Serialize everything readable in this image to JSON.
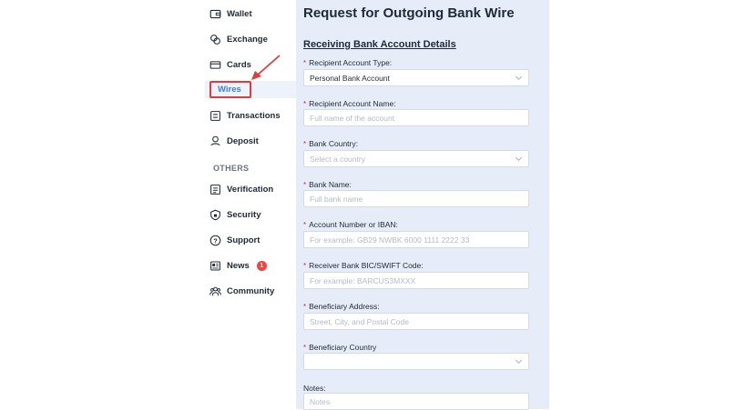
{
  "sidebar": {
    "items": [
      {
        "label": "Wallet",
        "icon": "wallet-icon"
      },
      {
        "label": "Exchange",
        "icon": "exchange-icon"
      },
      {
        "label": "Cards",
        "icon": "card-icon"
      },
      {
        "label": "Wires",
        "icon": "bank-icon"
      },
      {
        "label": "Transactions",
        "icon": "transactions-icon"
      },
      {
        "label": "Deposit",
        "icon": "deposit-icon"
      }
    ],
    "others_label": "OTHERS",
    "others": [
      {
        "label": "Verification",
        "icon": "verification-icon"
      },
      {
        "label": "Security",
        "icon": "shield-icon"
      },
      {
        "label": "Support",
        "icon": "help-icon"
      },
      {
        "label": "News",
        "icon": "news-icon",
        "badge": "1"
      },
      {
        "label": "Community",
        "icon": "community-icon"
      }
    ]
  },
  "form": {
    "title": "Request for Outgoing Bank Wire",
    "section": "Receiving Bank Account Details",
    "fields": [
      {
        "label": "Recipient Account Type:",
        "required": true,
        "value": "Personal Bank Account",
        "placeholder": "",
        "type": "select"
      },
      {
        "label": "Recipient Account Name:",
        "required": true,
        "value": "",
        "placeholder": "Full name of the account",
        "type": "text"
      },
      {
        "label": "Bank Country:",
        "required": true,
        "value": "",
        "placeholder": "Select a country",
        "type": "select"
      },
      {
        "label": "Bank Name:",
        "required": true,
        "value": "",
        "placeholder": "Full bank name",
        "type": "text"
      },
      {
        "label": "Account Number or IBAN:",
        "required": true,
        "value": "",
        "placeholder": "For example: GB29 NWBK 6000 1111 2222 33",
        "type": "text"
      },
      {
        "label": "Receiver Bank BIC/SWIFT Code:",
        "required": true,
        "value": "",
        "placeholder": "For example: BARCUS3MXXX",
        "type": "text"
      },
      {
        "label": "Beneficiary Address:",
        "required": true,
        "value": "",
        "placeholder": "Street, City, and Postal Code",
        "type": "text"
      },
      {
        "label": "Beneficiary Country",
        "required": true,
        "value": "",
        "placeholder": "",
        "type": "select"
      },
      {
        "label": "Notes:",
        "required": false,
        "value": "",
        "placeholder": "Notes",
        "type": "text"
      }
    ]
  },
  "colors": {
    "accent": "#3f7fd6",
    "highlight_border": "#e23b3b",
    "panel_bg": "#e6edf8",
    "required": "#e11d48"
  }
}
